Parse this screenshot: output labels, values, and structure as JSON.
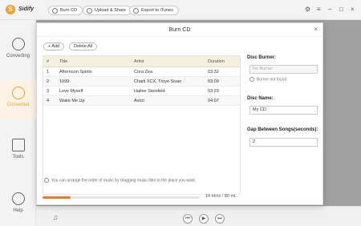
{
  "app": {
    "name": "Sidify",
    "logo": "S"
  },
  "toolbar": {
    "burn_cd": "Burn CD",
    "upload_share": "Upload & Share",
    "export_itunes": "Export to iTunes"
  },
  "window_controls": {
    "settings": "⚙",
    "menu": "≡",
    "minimize": "–",
    "maximize": "□",
    "close": "×"
  },
  "sidebar": {
    "items": [
      {
        "label": "Converting",
        "icon": "converting-icon"
      },
      {
        "label": "Converted",
        "icon": "clock-icon"
      },
      {
        "label": "Tools",
        "icon": "toolbox-icon"
      },
      {
        "label": "Help",
        "icon": "help-icon"
      }
    ]
  },
  "dialog": {
    "title": "Burn CD",
    "close": "×",
    "add_label": "+ Add",
    "delete_label": "Delete All",
    "columns": {
      "num": "#",
      "title": "Title",
      "artist": "Artist",
      "duration": "Duration"
    },
    "tracks": [
      {
        "num": "1",
        "title": "Afternoon Spirits",
        "artist": "Cora Zea",
        "duration": "03:32"
      },
      {
        "num": "2",
        "title": "1999",
        "artist": "Charli XCX, Troye Sivan",
        "duration": "03:09"
      },
      {
        "num": "3",
        "title": "Love Myself",
        "artist": "Hailee Steinfeld",
        "duration": "03:29"
      },
      {
        "num": "4",
        "title": "Wake Me Up",
        "artist": "Avicii",
        "duration": "04:07"
      }
    ],
    "hint": "You can arrange the order of music by dragging music files to the place you want.",
    "disc_burner_label": "Disc Burner:",
    "disc_burner_value": "No Burner",
    "burner_note": "Burner not found.",
    "disc_name_label": "Disc Name:",
    "disc_name_value": "My CD",
    "gap_label": "Gap Between Songs(seconds):",
    "gap_value": "2",
    "progress_text": "14 mins / 80 mi...",
    "progress_fraction": 0.18
  },
  "colors": {
    "accent": "#f0a02c",
    "progress": "#f0762c"
  }
}
